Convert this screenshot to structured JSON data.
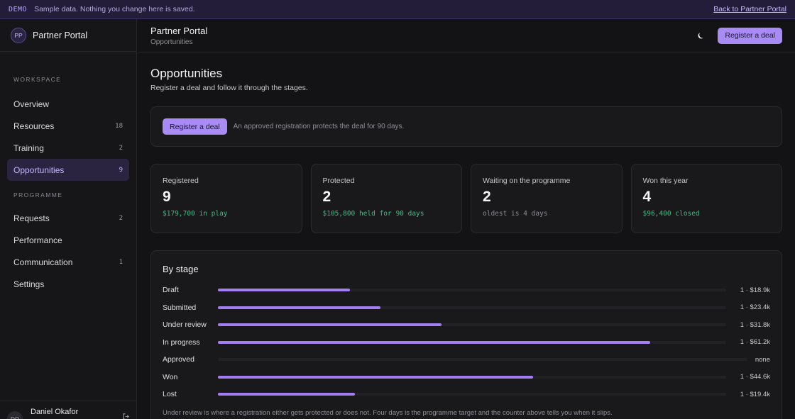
{
  "banner": {
    "tag": "DEMO",
    "message": "Sample data. Nothing you change here is saved.",
    "back_link": "Back to Partner Portal"
  },
  "sidebar": {
    "brand_initials": "PP",
    "brand_name": "Partner Portal",
    "sections": [
      {
        "label": "WORKSPACE",
        "items": [
          {
            "label": "Overview",
            "count": ""
          },
          {
            "label": "Resources",
            "count": "18"
          },
          {
            "label": "Training",
            "count": "2"
          },
          {
            "label": "Opportunities",
            "count": "9",
            "active": true
          }
        ]
      },
      {
        "label": "PROGRAMME",
        "items": [
          {
            "label": "Requests",
            "count": "2"
          },
          {
            "label": "Performance",
            "count": ""
          },
          {
            "label": "Communication",
            "count": "1"
          },
          {
            "label": "Settings",
            "count": ""
          }
        ]
      }
    ],
    "user": {
      "initials": "DO",
      "name": "Daniel Okafor"
    }
  },
  "header": {
    "title": "Partner Portal",
    "breadcrumb": "Opportunities",
    "register_button": "Register a deal"
  },
  "main": {
    "title": "Opportunities",
    "subtitle": "Register a deal and follow it through the stages.",
    "register_card": {
      "button": "Register a deal",
      "note": "An approved registration protects the deal for 90 days."
    },
    "stats": [
      {
        "label": "Registered",
        "value": "9",
        "detail": "$179,700 in play",
        "tone": "green"
      },
      {
        "label": "Protected",
        "value": "2",
        "detail": "$105,800 held for 90 days",
        "tone": "green"
      },
      {
        "label": "Waiting on the programme",
        "value": "2",
        "detail": "oldest is 4 days",
        "tone": "gray"
      },
      {
        "label": "Won this year",
        "value": "4",
        "detail": "$96,400 closed",
        "tone": "green"
      }
    ],
    "by_stage": {
      "title": "By stage",
      "stages": [
        {
          "name": "Draft",
          "value": "1 · $18.9k",
          "fraction": 0.26
        },
        {
          "name": "Submitted",
          "value": "1 · $23.4k",
          "fraction": 0.32
        },
        {
          "name": "Under review",
          "value": "1 · $31.8k",
          "fraction": 0.44
        },
        {
          "name": "In progress",
          "value": "1 · $61.2k",
          "fraction": 0.85
        },
        {
          "name": "Approved",
          "value": "none",
          "fraction": 0
        },
        {
          "name": "Won",
          "value": "1 · $44.6k",
          "fraction": 0.62
        },
        {
          "name": "Lost",
          "value": "1 · $19.4k",
          "fraction": 0.27
        }
      ],
      "footnote": "Under review is where a registration either gets protected or does not. Four days is the programme target and the counter above tells you when it slips."
    }
  },
  "colors": {
    "accent": "#a98bf5",
    "bar": "#a27ef2",
    "positive": "#3fbf7f",
    "banner_bg": "#231d3a"
  }
}
